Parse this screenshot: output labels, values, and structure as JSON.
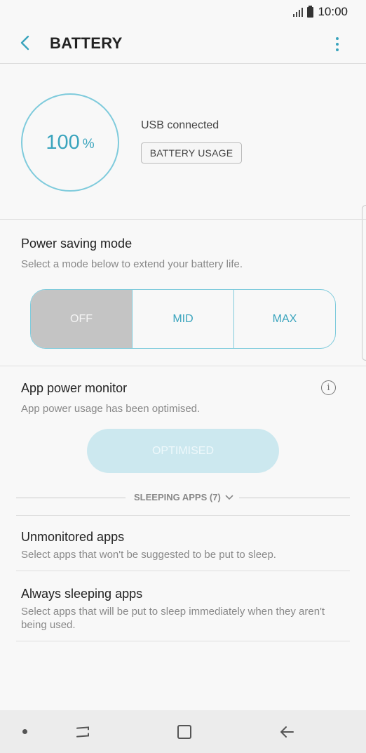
{
  "status_bar": {
    "time": "10:00"
  },
  "app_bar": {
    "title": "BATTERY"
  },
  "battery": {
    "percent": "100",
    "unit": "%",
    "status": "USB connected",
    "usage_button": "BATTERY USAGE"
  },
  "power_saving": {
    "title": "Power saving mode",
    "subtitle": "Select a mode below to extend your battery life.",
    "modes": [
      "OFF",
      "MID",
      "MAX"
    ],
    "selected": "OFF"
  },
  "app_power_monitor": {
    "title": "App power monitor",
    "subtitle": "App power usage has been optimised.",
    "button": "OPTIMISED"
  },
  "sleeping_apps": {
    "label": "SLEEPING APPS (7)"
  },
  "list_items": [
    {
      "title": "Unmonitored apps",
      "subtitle": "Select apps that won't be suggested to be put to sleep."
    },
    {
      "title": "Always sleeping apps",
      "subtitle": "Select apps that will be put to sleep immediately when they aren't being used."
    }
  ],
  "colors": {
    "accent": "#3aa4bd",
    "ring": "#7fcbdc",
    "selected_segment": "#c4c4c4",
    "optimised_button": "#cce8ef"
  },
  "icons": [
    "back-arrow-icon",
    "more-vert-icon",
    "info-icon",
    "chevron-down-icon",
    "recents-icon",
    "home-icon",
    "back-nav-icon"
  ]
}
